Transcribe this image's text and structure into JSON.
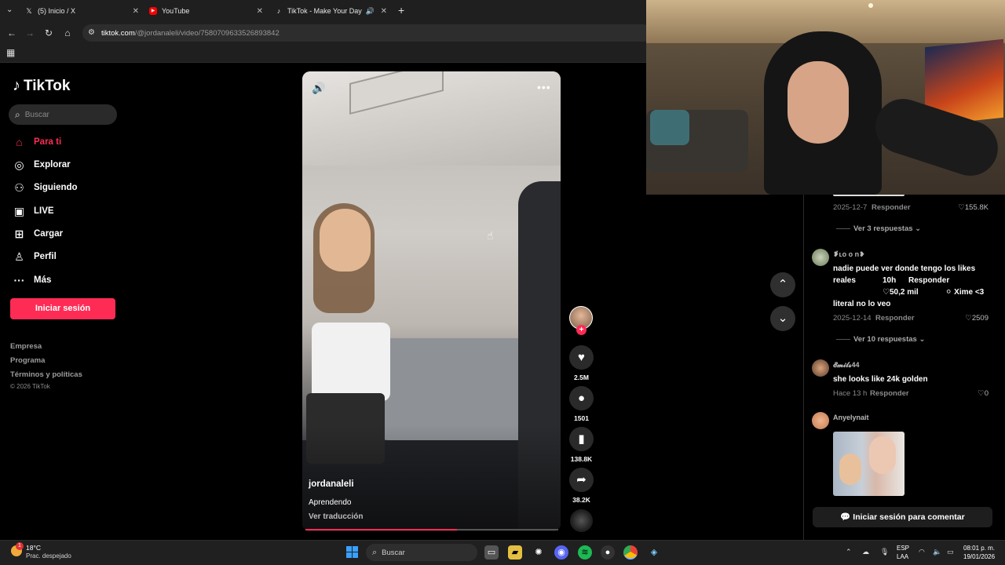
{
  "browser": {
    "tabs": [
      {
        "label": "(5) Inicio / X",
        "icon": "x-logo-icon"
      },
      {
        "label": "YouTube",
        "icon": "youtube-icon"
      },
      {
        "label": "TikTok - Make Your Day",
        "icon": "tiktok-icon"
      }
    ],
    "url_host": "tiktok.com",
    "url_path": "/@jordanaleli/video/7580709633526893842"
  },
  "sidebar": {
    "brand": "TikTok",
    "search_placeholder": "Buscar",
    "nav": [
      {
        "label": "Para ti",
        "icon": "home-icon",
        "active": true
      },
      {
        "label": "Explorar",
        "icon": "compass-icon"
      },
      {
        "label": "Siguiendo",
        "icon": "following-icon"
      },
      {
        "label": "LIVE",
        "icon": "live-icon"
      },
      {
        "label": "Cargar",
        "icon": "upload-icon"
      },
      {
        "label": "Perfil",
        "icon": "profile-icon"
      },
      {
        "label": "Más",
        "icon": "more-icon"
      }
    ],
    "login_label": "Iniciar sesión",
    "footer": [
      "Empresa",
      "Programa",
      "Términos y políticas"
    ],
    "copyright": "© 2026 TikTok"
  },
  "video": {
    "author": "jordanaleli",
    "description": "Aprendendo",
    "translate": "Ver traducción",
    "progress": 0.6,
    "likes": "2.5M",
    "comments": "1501",
    "saves": "138.8K",
    "shares": "38.2K"
  },
  "comments": [
    {
      "date": "2025-12-7",
      "reply": "Responder",
      "likes": "155.8K",
      "more": "Ver 3 respuestas"
    },
    {
      "user": "❥̽ʟᴏ o n❥",
      "text_line1": "nadie puede ver donde tengo los likes",
      "text_line2a": "reales",
      "text_line2b": "10h",
      "text_line2c": "Responder",
      "text_line3a": "♡50,2 mil",
      "text_line3b": "⚪ Xime <3",
      "text_line4": "literal no lo veo",
      "date": "2025-12-14",
      "reply": "Responder",
      "likes": "2509",
      "more": "Ver 10 respuestas"
    },
    {
      "user": "𝓔𝓶𝓲𝓵𝓼44",
      "text": "she looks like 24k golden",
      "date": "Hace 13 h",
      "reply": "Responder",
      "likes": "0"
    },
    {
      "user": "Anyelynait"
    }
  ],
  "comment_login": "Iniciar sesión para comentar",
  "taskbar": {
    "temp": "18°C",
    "weather": "Prac. despejado",
    "weather_badge": "1",
    "search": "Buscar",
    "lang1": "ESP",
    "lang2": "LAA",
    "time": "08:01 p. m.",
    "date": "19/01/2026"
  },
  "colors": {
    "accent": "#fe2c55",
    "background": "#000000"
  }
}
